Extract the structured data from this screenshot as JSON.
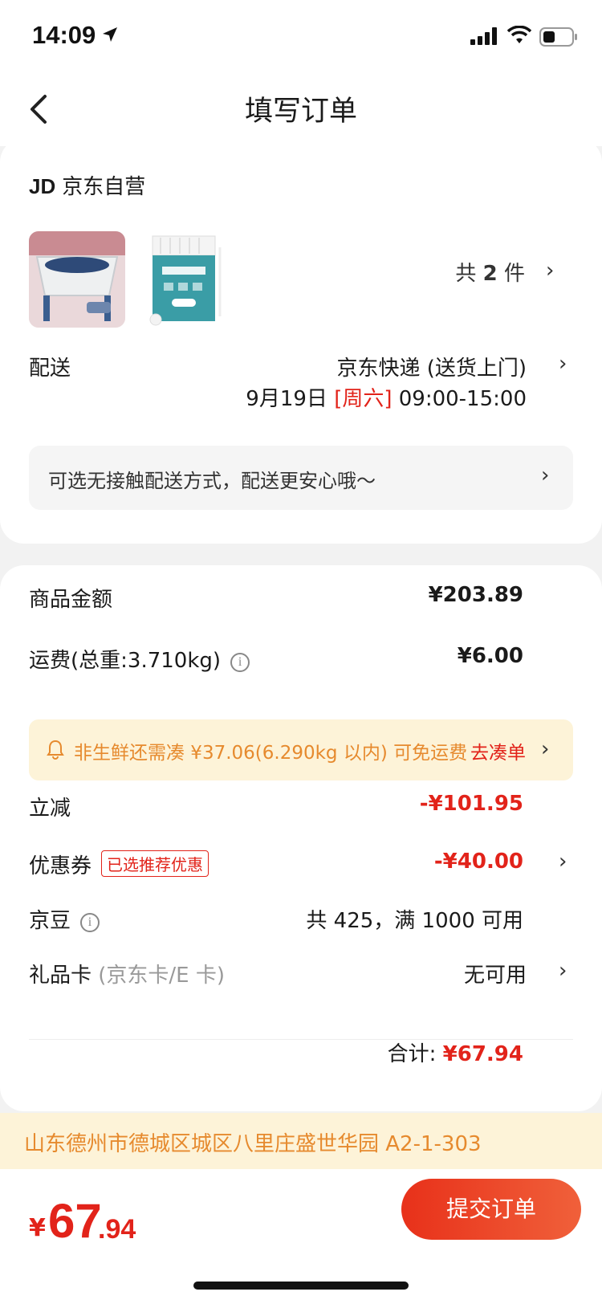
{
  "status": {
    "time": "14:09"
  },
  "nav": {
    "title": "填写订单"
  },
  "shop": {
    "logo": "JD",
    "name": "京东自营"
  },
  "products": {
    "count_prefix": "共",
    "count": "2",
    "count_suffix": "件"
  },
  "delivery": {
    "label": "配送",
    "method": "京东快递 (送货上门)",
    "date": "9月19日",
    "weekday": "[周六]",
    "time_range": "09:00-15:00",
    "contactless": "可选无接触配送方式，配送更安心哦～"
  },
  "summary": {
    "goods_label": "商品金额",
    "goods_value": "¥203.89",
    "shipping_label": "运费(总重:3.710kg)",
    "shipping_value": "¥6.00",
    "tip_text": "非生鲜还需凑 ¥37.06(6.290kg 以内) 可免运费",
    "tip_action": "去凑单",
    "discount_label": "立减",
    "discount_value": "-¥101.95",
    "coupon_label": "优惠券",
    "coupon_tag": "已选推荐优惠",
    "coupon_value": "-¥40.00",
    "beans_label": "京豆",
    "beans_value": "共 425，满 1000 可用",
    "giftcard_label": "礼品卡",
    "giftcard_sub": "(京东卡/E 卡)",
    "giftcard_value": "无可用",
    "total_label": "合计:",
    "total_value": "¥67.94"
  },
  "address": {
    "text": "山东德州市德城区城区八里庄盛世华园 A2-1-303"
  },
  "bottom": {
    "currency": "¥",
    "price_int": "67",
    "price_dec": ".94",
    "submit_label": "提交订单"
  },
  "colors": {
    "accent": "#e2231a",
    "tip": "#e68a2e",
    "tip_bg": "#fdf3d8"
  }
}
